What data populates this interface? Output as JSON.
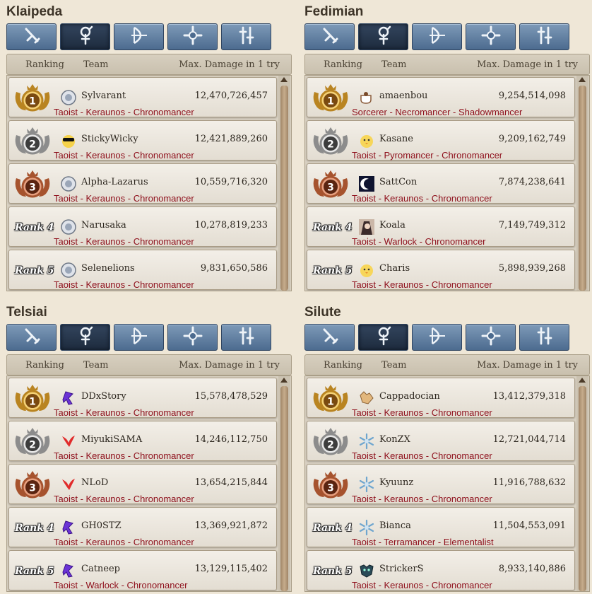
{
  "header": {
    "ranking": "Ranking",
    "team": "Team",
    "damage": "Max. Damage in 1 try"
  },
  "tabs": [
    "sword-class-icon",
    "wizard-class-icon",
    "archer-class-icon",
    "cleric-class-icon",
    "scout-class-icon"
  ],
  "colors": {
    "tab": "#5a7aa0",
    "tab_active": "#243246",
    "class_text": "#8e0f1b",
    "gold": "#d9a441",
    "silver": "#9c9c9c",
    "bronze": "#b86a43"
  },
  "servers": [
    {
      "title": "Klaipeda",
      "active_tab": 1,
      "entries": [
        {
          "rank": "1",
          "medal": "gold",
          "avatar": "sheep-icon",
          "name": "Sylvarant",
          "damage": "12,470,726,457",
          "classes": "Taoist - Keraunos - Chronomancer"
        },
        {
          "rank": "2",
          "medal": "silver",
          "avatar": "sunglasses-chick-icon",
          "name": "StickyWicky",
          "damage": "12,421,889,260",
          "classes": "Taoist - Keraunos - Chronomancer"
        },
        {
          "rank": "3",
          "medal": "bronze",
          "avatar": "sheep-icon",
          "name": "Alpha-Lazarus",
          "damage": "10,559,716,320",
          "classes": "Taoist - Keraunos - Chronomancer"
        },
        {
          "rank": "Rank 4",
          "medal": "none",
          "avatar": "sheep-icon",
          "name": "Narusaka",
          "damage": "10,278,819,233",
          "classes": "Taoist - Keraunos - Chronomancer"
        },
        {
          "rank": "Rank 5",
          "medal": "none",
          "avatar": "sheep-icon",
          "name": "Selenelions",
          "damage": "9,831,650,586",
          "classes": "Taoist - Keraunos - Chronomancer"
        }
      ]
    },
    {
      "title": "Fedimian",
      "active_tab": 1,
      "entries": [
        {
          "rank": "1",
          "medal": "gold",
          "avatar": "teacup-icon",
          "name": "amaenbou",
          "damage": "9,254,514,098",
          "classes": "Sorcerer - Necromancer - Shadowmancer"
        },
        {
          "rank": "2",
          "medal": "silver",
          "avatar": "chick-icon",
          "name": "Kasane",
          "damage": "9,209,162,749",
          "classes": "Taoist - Pyromancer - Chronomancer"
        },
        {
          "rank": "3",
          "medal": "bronze",
          "avatar": "moon-icon",
          "name": "SattCon",
          "damage": "7,874,238,641",
          "classes": "Taoist - Keraunos - Chronomancer"
        },
        {
          "rank": "Rank 4",
          "medal": "none",
          "avatar": "portrait-icon",
          "name": "Koala",
          "damage": "7,149,749,312",
          "classes": "Taoist - Warlock - Chronomancer"
        },
        {
          "rank": "Rank 5",
          "medal": "none",
          "avatar": "chick-icon",
          "name": "Charis",
          "damage": "5,898,939,268",
          "classes": "Taoist - Keraunos - Chronomancer"
        }
      ]
    },
    {
      "title": "Telsiai",
      "active_tab": 1,
      "entries": [
        {
          "rank": "1",
          "medal": "gold",
          "avatar": "purple-figure-icon",
          "name": "DDxStory",
          "damage": "15,578,478,529",
          "classes": "Taoist - Keraunos - Chronomancer"
        },
        {
          "rank": "2",
          "medal": "silver",
          "avatar": "red-bird-icon",
          "name": "MiyukiSAMA",
          "damage": "14,246,112,750",
          "classes": "Taoist - Keraunos - Chronomancer"
        },
        {
          "rank": "3",
          "medal": "bronze",
          "avatar": "red-bird-icon",
          "name": "NLoD",
          "damage": "13,654,215,844",
          "classes": "Taoist - Keraunos - Chronomancer"
        },
        {
          "rank": "Rank 4",
          "medal": "none",
          "avatar": "purple-figure-icon",
          "name": "GH0STZ",
          "damage": "13,369,921,872",
          "classes": "Taoist - Keraunos - Chronomancer"
        },
        {
          "rank": "Rank 5",
          "medal": "none",
          "avatar": "purple-figure-icon",
          "name": "Catneep",
          "damage": "13,129,115,402",
          "classes": "Taoist - Warlock - Chronomancer"
        }
      ]
    },
    {
      "title": "Silute",
      "active_tab": 1,
      "entries": [
        {
          "rank": "1",
          "medal": "gold",
          "avatar": "fox-icon",
          "name": "Cappadocian",
          "damage": "13,412,379,318",
          "classes": "Taoist - Keraunos - Chronomancer"
        },
        {
          "rank": "2",
          "medal": "silver",
          "avatar": "snowflake-icon",
          "name": "KonZX",
          "damage": "12,721,044,714",
          "classes": "Taoist - Keraunos - Chronomancer"
        },
        {
          "rank": "3",
          "medal": "bronze",
          "avatar": "snowflake-icon",
          "name": "Kyuunz",
          "damage": "11,916,788,632",
          "classes": "Taoist - Keraunos - Chronomancer"
        },
        {
          "rank": "Rank 4",
          "medal": "none",
          "avatar": "snowflake-icon",
          "name": "Bianca",
          "damage": "11,504,553,091",
          "classes": "Taoist - Terramancer - Elementalist"
        },
        {
          "rank": "Rank 5",
          "medal": "none",
          "avatar": "beast-mask-icon",
          "name": "StrickerS",
          "damage": "8,933,140,886",
          "classes": "Taoist - Keraunos - Chronomancer"
        }
      ]
    }
  ]
}
